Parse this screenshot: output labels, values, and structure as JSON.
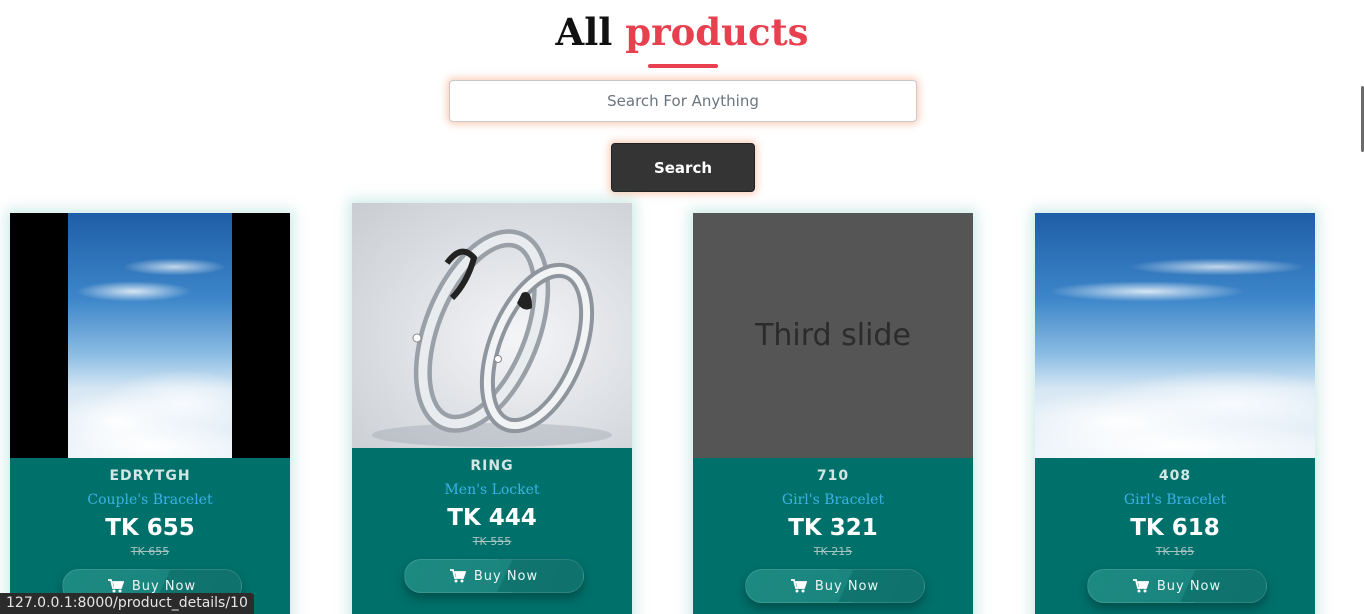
{
  "heading": {
    "word1": "All",
    "word2": "products"
  },
  "search": {
    "placeholder": "Search For Anything",
    "button_label": "Search"
  },
  "buy_label": "Buy Now",
  "products": [
    {
      "sku": "EDRYTGH",
      "name": "Couple's Bracelet",
      "price": "TK 655",
      "old_price": "TK 655",
      "image": "sky-pillarbox"
    },
    {
      "sku": "RING",
      "name": "Men's Locket",
      "price": "TK 444",
      "old_price": "TK 555",
      "image": "silver-rings"
    },
    {
      "sku": "710",
      "name": "Girl's Bracelet",
      "price": "TK 321",
      "old_price": "TK 215",
      "image": "placeholder",
      "image_text": "Third slide"
    },
    {
      "sku": "408",
      "name": "Girl's Bracelet",
      "price": "TK 618",
      "old_price": "TK 165",
      "image": "sky"
    }
  ],
  "status_url": "127.0.0.1:8000/product_details/10",
  "colors": {
    "accent": "#e8404e",
    "card": "#00706a",
    "price_link": "#3bb2e6",
    "button": "#343434"
  }
}
